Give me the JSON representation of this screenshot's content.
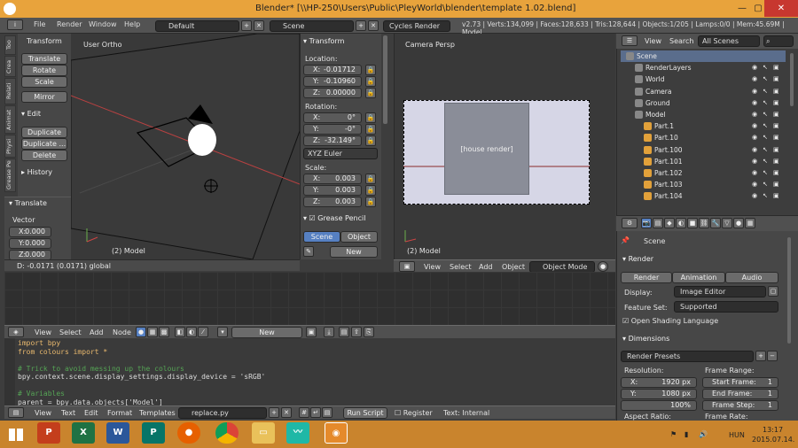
{
  "window": {
    "title": "Blender* [\\\\HP-250\\Users\\Public\\PleyWorld\\blender\\template 1.02.blend]",
    "minimize": "—",
    "maximize": "▢",
    "close": "✕"
  },
  "menubar": {
    "items": [
      "File",
      "Render",
      "Window",
      "Help"
    ],
    "layout": "Default",
    "scene": "Scene",
    "engine": "Cycles Render",
    "stats": "v2.73 | Verts:134,099 | Faces:128,633 | Tris:128,644 | Objects:1/205 | Lamps:0/0 | Mem:45.69M | Model"
  },
  "tools": {
    "tabs": [
      "Too",
      "Crea",
      "Relati",
      "Animat",
      "Physi",
      "Grease Pe"
    ],
    "transform_header": "Transform",
    "transform_buttons": [
      "Translate",
      "Rotate",
      "Scale"
    ],
    "mirror": "Mirror",
    "edit_header": "Edit",
    "edit_buttons": [
      "Duplicate",
      "Duplicate ...",
      "Delete"
    ],
    "history_header": "History"
  },
  "operator": {
    "header": "Translate",
    "vector_label": "Vector",
    "x": "0.000",
    "y": "0.000",
    "z": "0.000",
    "x_label": "X:",
    "y_label": "Y:",
    "z_label": "Z:"
  },
  "viewport_left": {
    "label": "User Ortho",
    "object": "(2) Model",
    "status": "D: -0.0171 (0.0171) global"
  },
  "npanel": {
    "header": "Transform",
    "location_label": "Location:",
    "loc": [
      {
        "l": "X:",
        "v": "-0.01712"
      },
      {
        "l": "Y:",
        "v": "-0.10960"
      },
      {
        "l": "Z:",
        "v": "0.00000"
      }
    ],
    "rotation_label": "Rotation:",
    "rot": [
      {
        "l": "X:",
        "v": "0°"
      },
      {
        "l": "Y:",
        "v": "-0°"
      },
      {
        "l": "Z:",
        "v": "-32.149°"
      }
    ],
    "euler": "XYZ Euler",
    "scale_label": "Scale:",
    "scale": [
      {
        "l": "X:",
        "v": "0.003"
      },
      {
        "l": "Y:",
        "v": "0.003"
      },
      {
        "l": "Z:",
        "v": "0.003"
      }
    ],
    "grease_header": "Grease Pencil",
    "scene_tab": "Scene",
    "object_tab": "Object",
    "new_btn": "New"
  },
  "viewport_right": {
    "label": "Camera Persp",
    "object": "(2) Model",
    "header_items": [
      "View",
      "Select",
      "Add",
      "Object"
    ],
    "mode": "Object Mode"
  },
  "outliner": {
    "view": "View",
    "search": "Search",
    "filter": "All Scenes",
    "rows": [
      {
        "name": "Scene",
        "indent": 0,
        "sel": true
      },
      {
        "name": "RenderLayers",
        "indent": 1
      },
      {
        "name": "World",
        "indent": 1
      },
      {
        "name": "Camera",
        "indent": 1
      },
      {
        "name": "Ground",
        "indent": 1
      },
      {
        "name": "Model",
        "indent": 1
      },
      {
        "name": "Part.1",
        "indent": 2
      },
      {
        "name": "Part.10",
        "indent": 2
      },
      {
        "name": "Part.100",
        "indent": 2
      },
      {
        "name": "Part.101",
        "indent": 2
      },
      {
        "name": "Part.102",
        "indent": 2
      },
      {
        "name": "Part.103",
        "indent": 2
      },
      {
        "name": "Part.104",
        "indent": 2
      }
    ]
  },
  "properties": {
    "scene": "Scene",
    "render_header": "Render",
    "render_buttons": [
      "Render",
      "Animation",
      "Audio"
    ],
    "display_label": "Display:",
    "display_value": "Image Editor",
    "feature_label": "Feature Set:",
    "feature_value": "Supported",
    "osl": "Open Shading Language",
    "dimensions_header": "Dimensions",
    "presets": "Render Presets",
    "resolution_label": "Resolution:",
    "res_x": "1920 px",
    "res_y": "1080 px",
    "res_pct": "100%",
    "x_label": "X:",
    "y_label": "Y:",
    "frame_range_label": "Frame Range:",
    "start": "Start Frame:",
    "end": "End Frame:",
    "step": "Frame Step:",
    "start_v": "1",
    "end_v": "1",
    "step_v": "1",
    "aspect": "Aspect Ratio:",
    "frame_rate": "Frame Rate:"
  },
  "node_header": {
    "items": [
      "View",
      "Select",
      "Add",
      "Node"
    ],
    "new": "New"
  },
  "code": [
    "import bpy",
    "from colours import *",
    "",
    "# Trick to avoid messing up the colours",
    "bpy.context.scene.display_settings.display_device = 'sRGB'",
    "",
    "# Variables",
    "parent = bpy.data.objects['Model']"
  ],
  "text_header": {
    "items": [
      "View",
      "Text",
      "Edit",
      "Format",
      "Templates"
    ],
    "file": "replace.py",
    "run": "Run Script",
    "register": "Register",
    "internal": "Text: Internal"
  },
  "taskbar": {
    "lang": "HUN",
    "time": "13:17",
    "date": "2015.07.14."
  }
}
